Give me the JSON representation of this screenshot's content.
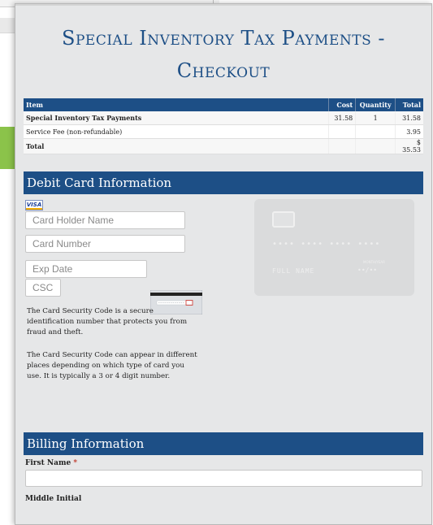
{
  "title": "Special Inventory Tax Payments - Checkout",
  "order_table": {
    "headers": [
      "Item",
      "Cost",
      "Quantity",
      "Total"
    ],
    "rows": [
      {
        "item": "Special Inventory Tax Payments",
        "cost": "31.58",
        "quantity": "1",
        "total": "31.58"
      },
      {
        "item": "Service Fee (non-refundable)",
        "cost": "",
        "quantity": "",
        "total": "3.95"
      },
      {
        "item": "Total",
        "cost": "",
        "quantity": "",
        "total": "$ 35.53"
      }
    ]
  },
  "debit_section": {
    "header": "Debit Card Information",
    "card_brand": "VISA",
    "card_holder_placeholder": "Card Holder Name",
    "card_number_placeholder": "Card Number",
    "exp_date_placeholder": "Exp Date",
    "csc_placeholder": "CSC",
    "csc_help_1": "The Card Security Code is a secure identification number that protects you from fraud and theft.",
    "csc_help_2": "The Card Security Code can appear in different places depending on which type of card you use. It is typically a 3 or 4 digit number."
  },
  "card_preview": {
    "number": "•••• •••• •••• ••••",
    "name": "FULL NAME",
    "exp_label": "MONTH/YEAR",
    "exp": "••/••"
  },
  "billing_section": {
    "header": "Billing Information",
    "first_name_label": "First Name",
    "required_mark": "*",
    "first_name_value": "",
    "middle_initial_label": "Middle Initial"
  },
  "colors": {
    "primary": "#1d4f86",
    "modal_bg": "#e6e7e8",
    "accent_green": "#8bc34a"
  }
}
